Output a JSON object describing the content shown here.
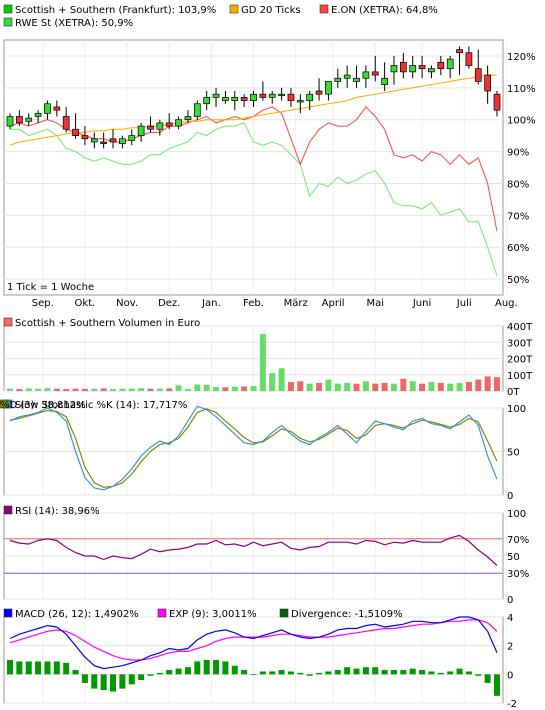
{
  "chart_data": [
    {
      "type": "candlestick",
      "legend": [
        {
          "label": "Scottish + Southern (Frankfurt): 103,9%",
          "color": "#00cc00"
        },
        {
          "label": "GD 20 Ticks",
          "color": "#ffaa00"
        },
        {
          "label": "E.ON (XETRA): 64,8%",
          "color": "#ff4444"
        },
        {
          "label": "RWE St (XETRA): 50,9%",
          "color": "#33dd33"
        }
      ],
      "note": "1 Tick = 1 Woche",
      "x_tick_labels": [
        "Sep.",
        "Okt.",
        "Nov.",
        "Dez.",
        "Jan.",
        "Feb.",
        "März",
        "April",
        "Mai",
        "Juni",
        "Juli",
        "Aug."
      ],
      "x_tick_weeks": [
        3.5,
        8,
        12.5,
        17,
        21.5,
        26,
        30.5,
        34.5,
        39,
        44,
        48.5,
        53
      ],
      "y_tick_labels": [
        "120%",
        "110%",
        "100%",
        "90%",
        "80%",
        "70%",
        "60%",
        "50%"
      ],
      "y_tick_values": [
        120,
        110,
        100,
        90,
        80,
        70,
        60,
        50
      ],
      "ylim": [
        45,
        125
      ],
      "series": [
        {
          "name": "Scottish + Southern (Frankfurt)",
          "open": [
            98,
            101,
            99.5,
            101,
            102,
            104,
            101,
            97,
            95,
            93,
            93,
            94,
            92.5,
            93.5,
            95,
            98,
            97,
            99,
            98,
            100,
            101,
            105,
            107,
            106,
            106,
            107,
            106,
            108,
            107,
            108,
            108,
            106,
            106,
            109,
            108,
            112,
            113,
            112,
            113,
            115,
            111,
            115,
            118,
            115,
            117,
            115,
            118,
            116,
            122,
            121,
            116,
            114,
            108
          ],
          "high": [
            102,
            103,
            102,
            103,
            106,
            106,
            104,
            102,
            98,
            96,
            96,
            97,
            95,
            97,
            99,
            101,
            100,
            102,
            101,
            103,
            106,
            109,
            110,
            109,
            109,
            108,
            109,
            112,
            109,
            110,
            110,
            108,
            109,
            113,
            110,
            116,
            117,
            117,
            117,
            120,
            118,
            120,
            121,
            120,
            120,
            117,
            120,
            120,
            123,
            123,
            122,
            117,
            109
          ],
          "low": [
            97,
            98,
            98,
            99,
            100,
            101,
            96,
            94,
            92,
            91,
            91,
            91,
            91,
            92,
            93,
            96,
            95,
            97,
            97,
            99,
            100,
            103,
            104,
            105,
            103,
            104,
            104,
            106,
            105,
            106,
            104,
            102,
            103,
            106,
            106,
            110,
            110,
            110,
            110,
            112,
            109,
            111,
            113,
            113,
            113,
            113,
            114,
            113,
            114,
            116,
            111,
            105,
            101
          ],
          "close": [
            101,
            99,
            100.5,
            102,
            105,
            103,
            97,
            95,
            94,
            94,
            92.5,
            93,
            94,
            95,
            98,
            97,
            99,
            98,
            100,
            101,
            105,
            107,
            108,
            107,
            107,
            106,
            108,
            107,
            108,
            108,
            106,
            106,
            108,
            108,
            112,
            113,
            114,
            113,
            115,
            114,
            113,
            117,
            115,
            117,
            116,
            116,
            116,
            119,
            121,
            117,
            112,
            109,
            103
          ]
        },
        {
          "name": "GD 20 Ticks",
          "values": [
            92,
            93,
            93.5,
            94,
            94.5,
            95,
            95.5,
            96,
            96,
            96.5,
            96.5,
            97,
            97,
            97.5,
            97.5,
            98,
            98,
            98.5,
            99,
            99.5,
            99.5,
            100,
            100,
            100,
            100,
            100.5,
            101,
            101.5,
            102,
            102.5,
            103,
            103.5,
            104,
            104.5,
            105,
            105.5,
            106,
            107,
            107.5,
            108,
            108.5,
            109,
            109.5,
            110,
            110.5,
            111,
            111.5,
            112,
            112.5,
            113,
            113.5,
            114,
            114
          ]
        },
        {
          "name": "E.ON (XETRA)",
          "values": [
            98,
            99,
            98,
            99,
            100,
            99,
            97,
            96,
            95,
            94,
            94,
            93,
            93,
            94,
            95,
            96,
            96,
            98,
            98,
            99,
            100,
            101,
            99,
            100,
            101,
            100,
            101,
            103,
            104,
            102,
            94,
            86,
            93,
            97,
            99,
            98,
            98,
            100,
            104,
            101,
            97,
            89,
            88,
            89,
            87,
            90,
            89,
            86,
            89,
            86,
            88,
            80,
            65
          ]
        },
        {
          "name": "RWE St (XETRA)",
          "values": [
            97,
            97,
            95,
            96,
            97,
            95,
            91,
            90,
            88,
            87,
            88,
            87,
            86,
            86,
            87,
            89,
            89,
            91,
            92,
            93,
            96,
            95,
            97,
            98,
            98,
            99,
            93,
            92,
            93,
            92,
            89,
            86,
            76,
            80,
            79,
            82,
            80,
            81,
            83,
            84,
            80,
            74,
            73,
            73,
            72,
            74,
            70,
            71,
            72,
            68,
            68,
            60,
            51
          ]
        }
      ]
    },
    {
      "type": "bar",
      "legend": [
        {
          "label": "Scottish + Southern Volumen in Euro",
          "color": "#ff6666"
        }
      ],
      "y_tick_labels": [
        "400T",
        "300T",
        "200T",
        "100T",
        "0T"
      ],
      "y_tick_values": [
        400,
        300,
        200,
        100,
        0
      ],
      "ylim": [
        0,
        400
      ],
      "up_color": "#66dd66",
      "down_color": "#ee6666",
      "values": [
        15,
        12,
        16,
        14,
        18,
        14,
        12,
        15,
        13,
        14,
        16,
        12,
        14,
        15,
        18,
        14,
        15,
        16,
        35,
        13,
        40,
        38,
        25,
        23,
        26,
        28,
        30,
        350,
        110,
        140,
        55,
        60,
        45,
        50,
        70,
        45,
        50,
        45,
        60,
        45,
        50,
        45,
        75,
        60,
        45,
        55,
        50,
        45,
        50,
        55,
        70,
        90,
        85
      ],
      "up": [
        1,
        0,
        1,
        1,
        1,
        0,
        0,
        0,
        0,
        1,
        0,
        1,
        1,
        1,
        1,
        0,
        1,
        0,
        1,
        1,
        1,
        1,
        1,
        0,
        1,
        0,
        1,
        1,
        1,
        1,
        0,
        0,
        1,
        0,
        1,
        1,
        1,
        0,
        1,
        0,
        0,
        1,
        0,
        1,
        0,
        1,
        0,
        1,
        1,
        0,
        0,
        0,
        0
      ]
    },
    {
      "type": "line",
      "legend": [
        {
          "label": "Slow Stochastic %K (14): 17,717%",
          "color": "#3399cc"
        },
        {
          "label": "%D (3): 38,812%",
          "color": "#888800"
        }
      ],
      "y_tick_labels": [
        "100",
        "50",
        "0"
      ],
      "y_tick_values": [
        100,
        50,
        0
      ],
      "ylim": [
        0,
        100
      ],
      "series": [
        {
          "name": "Slow Stochastic %K (14)",
          "values": [
            85,
            90,
            92,
            95,
            100,
            95,
            85,
            50,
            20,
            8,
            6,
            10,
            18,
            30,
            45,
            55,
            62,
            58,
            68,
            85,
            102,
            98,
            90,
            80,
            70,
            60,
            58,
            62,
            72,
            80,
            70,
            62,
            58,
            66,
            72,
            80,
            70,
            60,
            73,
            85,
            82,
            78,
            75,
            85,
            88,
            82,
            80,
            76,
            84,
            92,
            80,
            45,
            18
          ]
        },
        {
          "name": "%D (3)",
          "values": [
            86,
            88,
            91,
            94,
            97,
            96,
            90,
            65,
            32,
            14,
            9,
            10,
            14,
            24,
            38,
            50,
            58,
            60,
            65,
            78,
            95,
            99,
            95,
            85,
            76,
            66,
            60,
            61,
            68,
            76,
            73,
            65,
            61,
            64,
            70,
            77,
            74,
            65,
            69,
            80,
            82,
            80,
            77,
            82,
            86,
            84,
            81,
            78,
            81,
            88,
            84,
            62,
            39
          ]
        }
      ]
    },
    {
      "type": "line",
      "legend": [
        {
          "label": "RSI (14): 38,96%",
          "color": "#880088"
        }
      ],
      "y_tick_labels": [
        "100",
        "70%",
        "50",
        "30%",
        "0"
      ],
      "y_tick_values": [
        100,
        70,
        50,
        30,
        0
      ],
      "ylim": [
        0,
        100
      ],
      "ref_lines": [
        {
          "label": "70%",
          "value": 70,
          "color": "#ff6666"
        },
        {
          "label": "30%",
          "value": 30,
          "color": "#6666ff"
        }
      ],
      "series": [
        {
          "name": "RSI (14)",
          "values": [
            68,
            65,
            64,
            68,
            70,
            68,
            60,
            54,
            50,
            50,
            46,
            50,
            48,
            47,
            52,
            58,
            55,
            57,
            58,
            60,
            64,
            64,
            68,
            63,
            64,
            61,
            66,
            62,
            64,
            66,
            59,
            57,
            60,
            61,
            66,
            66,
            66,
            64,
            68,
            67,
            63,
            66,
            65,
            68,
            66,
            66,
            66,
            71,
            74,
            67,
            57,
            49,
            39
          ]
        }
      ]
    },
    {
      "type": "line",
      "legend": [
        {
          "label": "MACD (26, 12): 1,4902%",
          "color": "#0000ff"
        },
        {
          "label": "EXP (9): 3,0011%",
          "color": "#ff00ff"
        },
        {
          "label": "Divergence: -1,5109%",
          "color": "#006600"
        }
      ],
      "y_tick_labels": [
        "4",
        "2",
        "0",
        "-2"
      ],
      "y_tick_values": [
        4,
        2,
        0,
        -2
      ],
      "ylim": [
        -2,
        4
      ],
      "series": [
        {
          "name": "MACD (26, 12)",
          "values": [
            2.5,
            2.8,
            3.0,
            3.2,
            3.4,
            3.3,
            2.8,
            2.0,
            1.2,
            0.6,
            0.4,
            0.5,
            0.6,
            0.8,
            1.0,
            1.3,
            1.5,
            1.8,
            1.7,
            1.8,
            2.4,
            2.8,
            3.0,
            3.1,
            2.9,
            2.6,
            2.5,
            2.7,
            2.9,
            3.1,
            2.8,
            2.6,
            2.5,
            2.6,
            2.8,
            3.1,
            3.2,
            3.2,
            3.4,
            3.5,
            3.3,
            3.4,
            3.5,
            3.7,
            3.7,
            3.6,
            3.6,
            3.8,
            4.0,
            4.0,
            3.8,
            3.0,
            1.5
          ]
        },
        {
          "name": "EXP (9)",
          "values": [
            2.2,
            2.4,
            2.6,
            2.8,
            3.0,
            3.1,
            3.0,
            2.7,
            2.3,
            1.9,
            1.6,
            1.3,
            1.1,
            1.0,
            1.0,
            1.1,
            1.3,
            1.5,
            1.6,
            1.6,
            1.8,
            2.0,
            2.3,
            2.5,
            2.6,
            2.6,
            2.6,
            2.6,
            2.7,
            2.8,
            2.8,
            2.7,
            2.6,
            2.6,
            2.6,
            2.7,
            2.8,
            2.9,
            3.0,
            3.1,
            3.2,
            3.2,
            3.3,
            3.4,
            3.5,
            3.5,
            3.6,
            3.7,
            3.7,
            3.8,
            3.8,
            3.6,
            3.0
          ]
        },
        {
          "name": "Divergence",
          "values": [
            1.0,
            0.9,
            0.9,
            0.9,
            0.9,
            0.9,
            0.8,
            0.3,
            -0.6,
            -1.0,
            -1.1,
            -1.2,
            -1.0,
            -0.7,
            -0.4,
            -0.1,
            0.1,
            0.3,
            0.4,
            0.5,
            0.9,
            1.0,
            1.0,
            0.9,
            0.6,
            0.3,
            0.0,
            0.2,
            0.2,
            0.3,
            0.2,
            0.1,
            -0.1,
            0.1,
            0.2,
            0.3,
            0.5,
            0.4,
            0.5,
            0.5,
            0.3,
            0.3,
            0.3,
            0.4,
            0.3,
            0.2,
            0.1,
            0.2,
            0.4,
            0.2,
            -0.1,
            -0.6,
            -1.5
          ]
        }
      ]
    }
  ]
}
